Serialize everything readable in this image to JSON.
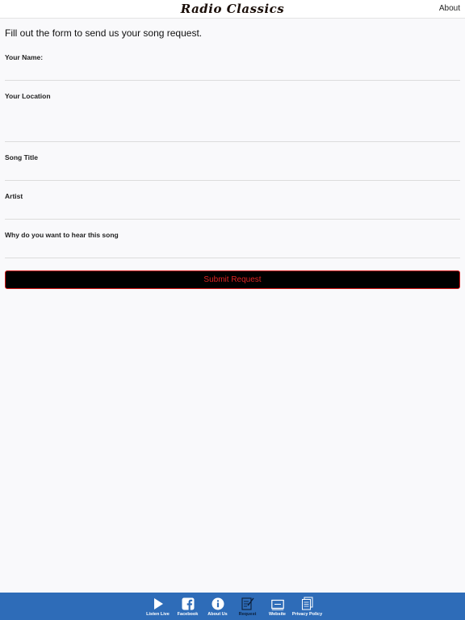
{
  "header": {
    "title": "Radio Classics",
    "about_label": "About"
  },
  "form": {
    "intro": "Fill out the form to send us your song request.",
    "fields": [
      {
        "label": "Your Name:",
        "value": ""
      },
      {
        "label": "Your Location",
        "value": ""
      },
      {
        "label": "Song Title",
        "value": ""
      },
      {
        "label": "Artist",
        "value": ""
      },
      {
        "label": "Why do you want to hear this song",
        "value": ""
      }
    ],
    "submit_label": "Submit Request"
  },
  "tabbar": {
    "tabs": [
      {
        "label": "Listen Live",
        "icon": "play-icon"
      },
      {
        "label": "Facebook",
        "icon": "facebook-icon"
      },
      {
        "label": "About Us",
        "icon": "info-icon"
      },
      {
        "label": "Request",
        "icon": "edit-icon",
        "active": true
      },
      {
        "label": "Website",
        "icon": "browser-icon"
      },
      {
        "label": "Privacy Policy",
        "icon": "document-icon"
      }
    ]
  },
  "colors": {
    "tabbar": "#2e6cb8",
    "submit_bg": "#000000",
    "submit_text": "#e02424",
    "active_tab_label": "#0c1f3a"
  }
}
